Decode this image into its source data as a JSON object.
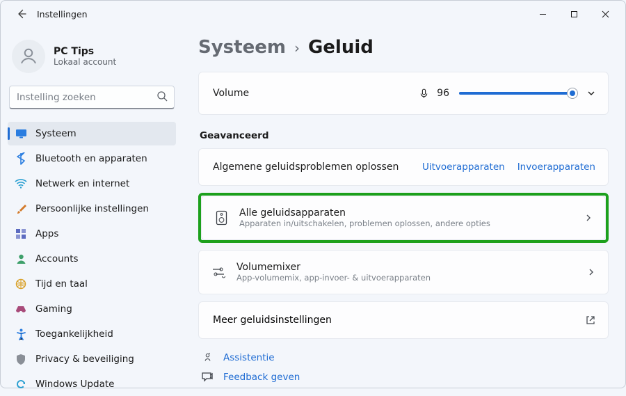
{
  "window": {
    "title": "Instellingen"
  },
  "account": {
    "name": "PC Tips",
    "subtitle": "Lokaal account"
  },
  "search": {
    "placeholder": "Instelling zoeken"
  },
  "nav": {
    "items": [
      {
        "label": "Systeem",
        "icon": "display-icon",
        "color": "#2a7de0"
      },
      {
        "label": "Bluetooth en apparaten",
        "icon": "bluetooth-icon",
        "color": "#2a7de0"
      },
      {
        "label": "Netwerk en internet",
        "icon": "wifi-icon",
        "color": "#2a9fd1"
      },
      {
        "label": "Persoonlijke instellingen",
        "icon": "brush-icon",
        "color": "#d37a2a"
      },
      {
        "label": "Apps",
        "icon": "apps-icon",
        "color": "#5c6bc0"
      },
      {
        "label": "Accounts",
        "icon": "person-icon",
        "color": "#3fa06b"
      },
      {
        "label": "Tijd en taal",
        "icon": "globe-icon",
        "color": "#d9a12a"
      },
      {
        "label": "Gaming",
        "icon": "gamepad-icon",
        "color": "#a84b7a"
      },
      {
        "label": "Toegankelijkheid",
        "icon": "accessibility-icon",
        "color": "#2a7de0"
      },
      {
        "label": "Privacy & beveiliging",
        "icon": "shield-icon",
        "color": "#8a8f97"
      },
      {
        "label": "Windows Update",
        "icon": "update-icon",
        "color": "#2a9fd1"
      }
    ],
    "active_index": 0
  },
  "breadcrumb": {
    "parent": "Systeem",
    "current": "Geluid"
  },
  "volume": {
    "label": "Volume",
    "value": 96
  },
  "sections": {
    "advanced": "Geavanceerd"
  },
  "troubleshoot": {
    "title": "Algemene geluidsproblemen oplossen",
    "output_label": "Uitvoerapparaten",
    "input_label": "Invoerapparaten"
  },
  "all_devices": {
    "title": "Alle geluidsapparaten",
    "subtitle": "Apparaten in/uitschakelen, problemen oplossen, andere opties"
  },
  "mixer": {
    "title": "Volumemixer",
    "subtitle": "App-volumemix, app-invoer- & uitvoerapparaten"
  },
  "more": {
    "label": "Meer geluidsinstellingen"
  },
  "footer": {
    "assist": "Assistentie",
    "feedback": "Feedback geven"
  }
}
